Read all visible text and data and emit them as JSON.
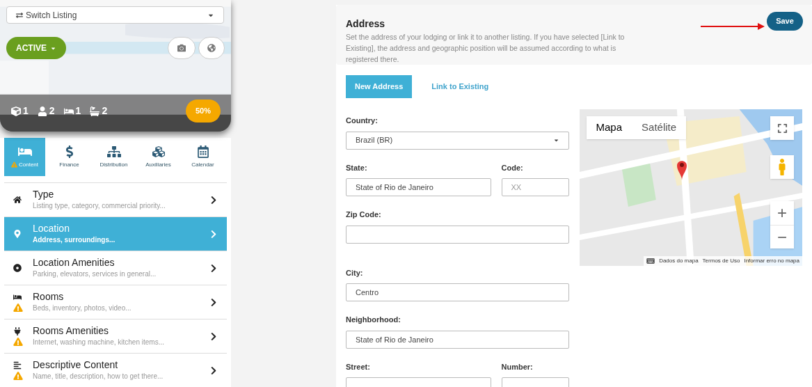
{
  "listing": {
    "switch_label": "Switch Listing",
    "status": "ACTIVE",
    "stats": [
      {
        "kind": "box",
        "value": "1"
      },
      {
        "kind": "person",
        "value": "2"
      },
      {
        "kind": "bed",
        "value": "1"
      },
      {
        "kind": "bath",
        "value": "2"
      }
    ],
    "completion": "50%"
  },
  "sections": [
    {
      "label": "Content",
      "kind": "bed",
      "selected": true,
      "warning": true
    },
    {
      "label": "Finance",
      "kind": "dollar",
      "selected": false,
      "warning": false
    },
    {
      "label": "Distribution",
      "kind": "sitemap",
      "selected": false,
      "warning": false
    },
    {
      "label": "Auxiliaries",
      "kind": "cubes",
      "selected": false,
      "warning": false
    },
    {
      "label": "Calendar",
      "kind": "calendar",
      "selected": false,
      "warning": false
    }
  ],
  "menu": [
    {
      "title": "Type",
      "subtitle": "Listing type, category, commercial priority...",
      "kind": "home",
      "selected": false,
      "warning": false
    },
    {
      "title": "Location",
      "subtitle": "Address, surroundings...",
      "kind": "pin",
      "selected": true,
      "warning": false
    },
    {
      "title": "Location Amenities",
      "subtitle": "Parking, elevators, services in general...",
      "kind": "target",
      "selected": false,
      "warning": false
    },
    {
      "title": "Rooms",
      "subtitle": "Beds, inventory, photos, video...",
      "kind": "bed",
      "selected": false,
      "warning": true
    },
    {
      "title": "Rooms Amenities",
      "subtitle": "Internet, washing machine, kitchen items...",
      "kind": "plug",
      "selected": false,
      "warning": true
    },
    {
      "title": "Descriptive Content",
      "subtitle": "Name, title, description, how to get there...",
      "kind": "lines",
      "selected": false,
      "warning": true
    }
  ],
  "header": {
    "title": "Address",
    "description": "Set the address of your lodging or link it to another listing. If you have selected [Link to Existing], the address and geographic position will be assumed according to what is registered there.",
    "save": "Save"
  },
  "tabs": [
    {
      "label": "New Address",
      "selected": true
    },
    {
      "label": "Link to Existing",
      "selected": false
    }
  ],
  "form": {
    "country": {
      "label": "Country:",
      "value": "Brazil (BR)"
    },
    "state": {
      "label": "State:",
      "value": "State of Rio de Janeiro"
    },
    "code": {
      "label": "Code:",
      "placeholder": "XX"
    },
    "zip": {
      "label": "Zip Code:"
    },
    "city": {
      "label": "City:",
      "value": "Centro"
    },
    "neighborhood": {
      "label": "Neighborhood:",
      "value": "State of Rio de Janeiro"
    },
    "street": {
      "label": "Street:"
    },
    "number": {
      "label": "Number:"
    }
  },
  "map": {
    "types": [
      {
        "label": "Mapa",
        "selected": true
      },
      {
        "label": "Satélite",
        "selected": false
      }
    ],
    "zoom_in": "+",
    "zoom_out": "−",
    "footer": [
      "Dados do mapa",
      "Termos de Uso",
      "Informar erro no mapa"
    ]
  }
}
